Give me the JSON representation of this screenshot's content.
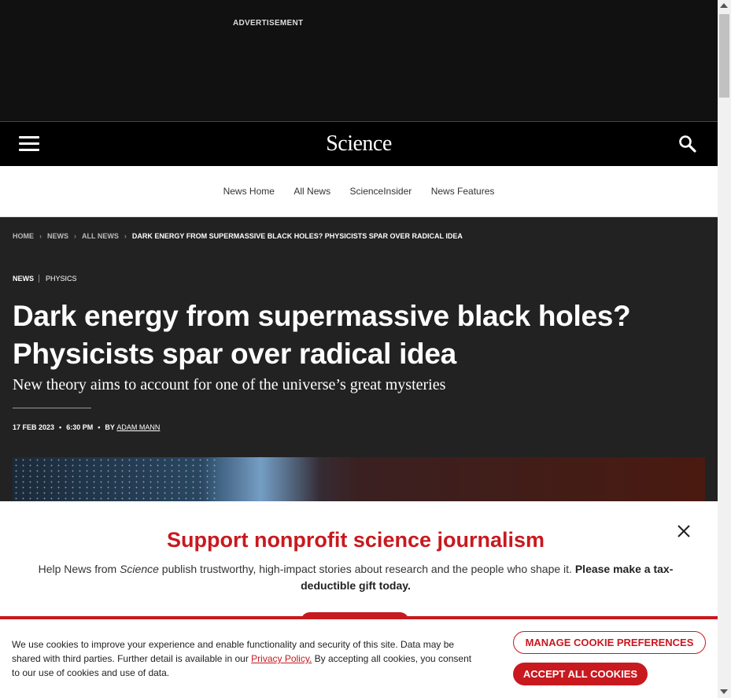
{
  "ad": {
    "label": "ADVERTISEMENT"
  },
  "header": {
    "logo": "Science",
    "menu_icon": "hamburger-icon",
    "search_icon": "search-icon"
  },
  "subnav": {
    "items": [
      "News Home",
      "All News",
      "ScienceInsider",
      "News Features"
    ]
  },
  "breadcrumb": {
    "items": [
      "HOME",
      "NEWS",
      "ALL NEWS"
    ],
    "current": "DARK ENERGY FROM SUPERMASSIVE BLACK HOLES? PHYSICISTS SPAR OVER RADICAL IDEA"
  },
  "article": {
    "tags": [
      "NEWS",
      "PHYSICS"
    ],
    "title": "Dark energy from supermassive black holes? Physicists spar over radical idea",
    "subtitle": "New theory aims to account for one of the universe’s great mysteries",
    "date": "17 FEB 2023",
    "time": "6:30 PM",
    "by": "BY",
    "author": "ADAM MANN"
  },
  "donate": {
    "title": "Support nonprofit science journalism",
    "body_pre": "Help News from ",
    "body_em": "Science",
    "body_mid": " publish trustworthy, high-impact stories about research and the people who shape it. ",
    "body_bold": "Please make a tax-deductible gift today."
  },
  "cookie": {
    "text_pre": "We use cookies to improve your experience and enable functionality and security of this site. Data may be shared with third parties. Further detail is available in our ",
    "link": "Privacy Policy.",
    "text_post": " By accepting all cookies, you consent to our use of cookies and use of data.",
    "manage_label": "MANAGE COOKIE PREFERENCES",
    "accept_label": "ACCEPT ALL COOKIES"
  },
  "colors": {
    "accent": "#c8191f",
    "dark_bg": "#222222",
    "header_bg": "#000000"
  }
}
